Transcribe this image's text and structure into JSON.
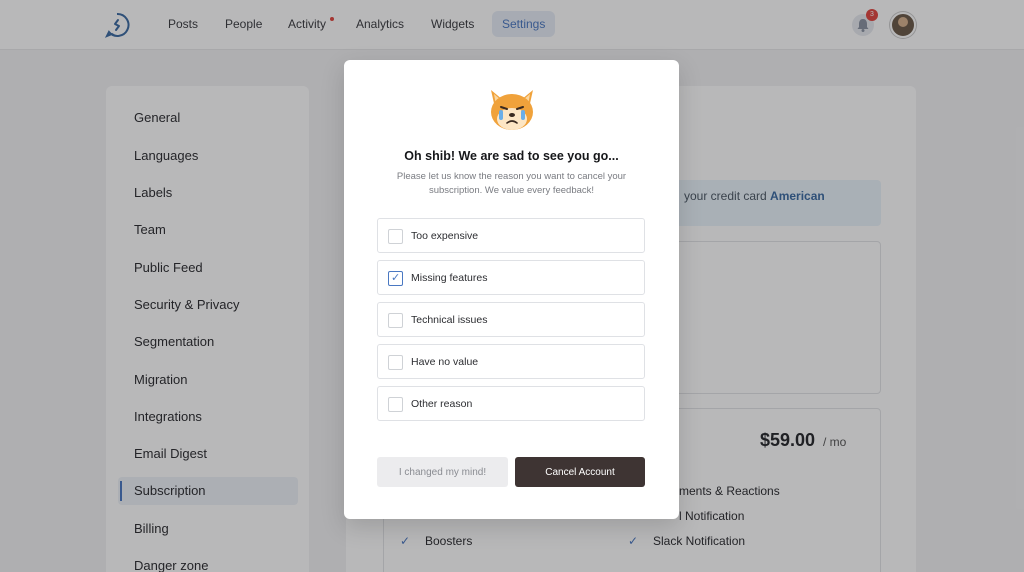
{
  "nav": {
    "items": [
      {
        "label": "Posts"
      },
      {
        "label": "People"
      },
      {
        "label": "Activity"
      },
      {
        "label": "Analytics"
      },
      {
        "label": "Widgets"
      },
      {
        "label": "Settings"
      }
    ],
    "active": "Settings",
    "notification_count": "3"
  },
  "sidebar": {
    "items": [
      {
        "label": "General"
      },
      {
        "label": "Languages"
      },
      {
        "label": "Labels"
      },
      {
        "label": "Team"
      },
      {
        "label": "Public Feed"
      },
      {
        "label": "Security & Privacy"
      },
      {
        "label": "Segmentation"
      },
      {
        "label": "Migration"
      },
      {
        "label": "Integrations"
      },
      {
        "label": "Email Digest"
      },
      {
        "label": "Subscription"
      },
      {
        "label": "Billing"
      },
      {
        "label": "Danger zone"
      }
    ],
    "active": "Subscription"
  },
  "background": {
    "banner_text": "your credit card ",
    "banner_bold": "American",
    "price": "$59.00",
    "price_unit": "/ mo",
    "features": [
      {
        "label": "ments & Reactions"
      },
      {
        "label": "l Notification"
      },
      {
        "label": "Boosters"
      },
      {
        "label": "Slack Notification"
      }
    ]
  },
  "modal": {
    "title": "Oh shib! We are sad to see you go...",
    "subtitle": "Please let us know the reason you want to cancel your subscription. We value every feedback!",
    "options": [
      {
        "label": "Too expensive",
        "checked": false
      },
      {
        "label": "Missing features",
        "checked": true
      },
      {
        "label": "Technical issues",
        "checked": false
      },
      {
        "label": "Have no value",
        "checked": false
      },
      {
        "label": "Other reason",
        "checked": false
      }
    ],
    "secondary_button": "I changed my mind!",
    "primary_button": "Cancel Account"
  },
  "colors": {
    "accent": "#4a78c2",
    "primary_button": "#3e3433",
    "badge": "#e2463f"
  }
}
